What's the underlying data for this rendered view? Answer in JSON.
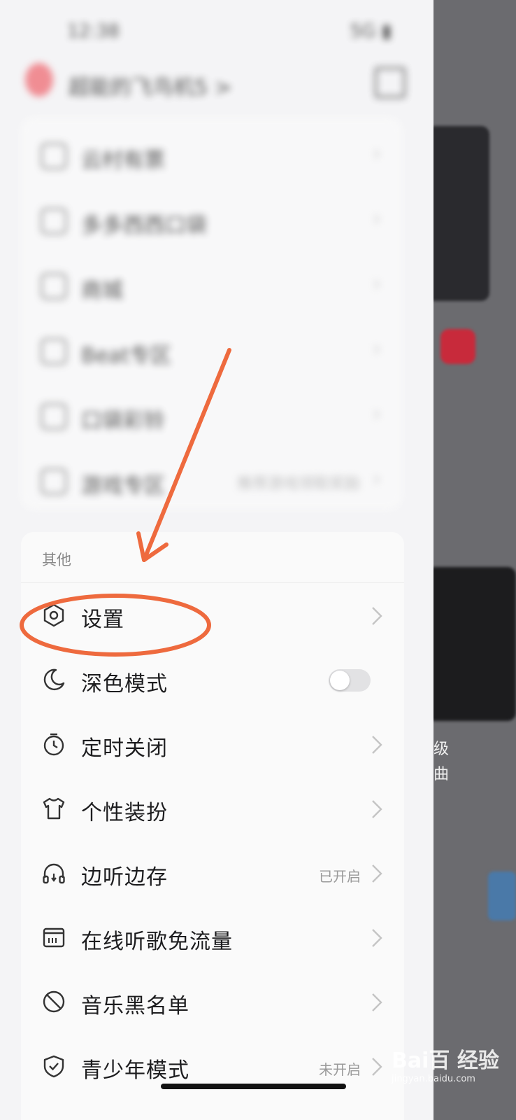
{
  "status_bar": {
    "time": "12:38",
    "indicators": "5G ▮"
  },
  "profile": {
    "username": "超能的飞鸟机5 >"
  },
  "top_section": {
    "items": [
      {
        "label": "云村有票",
        "hint": ""
      },
      {
        "label": "多多西西口袋",
        "hint": ""
      },
      {
        "label": "商城",
        "hint": ""
      },
      {
        "label": "Beat专区",
        "hint": ""
      },
      {
        "label": "口袋彩铃",
        "hint": ""
      },
      {
        "label": "游戏专区",
        "hint": "推荐游戏领取奖励"
      }
    ]
  },
  "other_section": {
    "title": "其他",
    "items": [
      {
        "label": "设置",
        "status": "",
        "icon": "settings-hexagon-icon"
      },
      {
        "label": "深色模式",
        "status": "",
        "icon": "moon-icon"
      },
      {
        "label": "定时关闭",
        "status": "",
        "icon": "timer-icon"
      },
      {
        "label": "个性装扮",
        "status": "",
        "icon": "tshirt-icon"
      },
      {
        "label": "边听边存",
        "status": "已开启",
        "icon": "headphones-icon"
      },
      {
        "label": "在线听歌免流量",
        "status": "",
        "icon": "data-card-icon"
      },
      {
        "label": "音乐黑名单",
        "status": "",
        "icon": "block-icon"
      },
      {
        "label": "青少年模式",
        "status": "未开启",
        "icon": "shield-check-icon"
      }
    ],
    "dark_mode_on": false
  },
  "background": {
    "text_1": "级",
    "text_2": "曲"
  },
  "watermark": {
    "brand": "Bai百 经验",
    "url": "jingyan.baidu.com"
  },
  "colors": {
    "annotation": "#ee6a3e"
  }
}
